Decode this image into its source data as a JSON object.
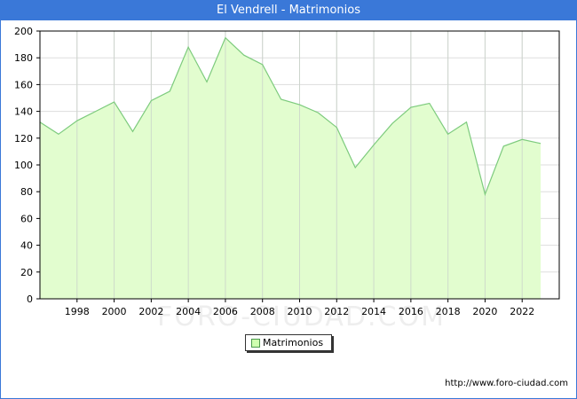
{
  "title": "El Vendrell - Matrimonios",
  "source_url": "http://www.foro-ciudad.com",
  "watermark": "FORO-CIUDAD.COM",
  "colors": {
    "title_bg": "#3a78d8",
    "fill": "#e2fdcf",
    "line": "#7dcb7d",
    "grid": "#dddddd",
    "swatch": "#cfffb0"
  },
  "chart_data": {
    "type": "area",
    "x": [
      1996,
      1997,
      1998,
      1999,
      2000,
      2001,
      2002,
      2003,
      2004,
      2005,
      2006,
      2007,
      2008,
      2009,
      2010,
      2011,
      2012,
      2013,
      2014,
      2015,
      2016,
      2017,
      2018,
      2019,
      2020,
      2021,
      2022,
      2023
    ],
    "series": [
      {
        "name": "Matrimonios",
        "values": [
          132,
          123,
          133,
          140,
          147,
          125,
          148,
          155,
          188,
          162,
          195,
          182,
          175,
          149,
          145,
          139,
          128,
          98,
          115,
          131,
          143,
          146,
          123,
          132,
          78,
          114,
          119,
          116
        ]
      }
    ],
    "xlim": [
      1996,
      2024
    ],
    "ylim": [
      0,
      200
    ],
    "xticks": [
      1998,
      2000,
      2002,
      2004,
      2006,
      2008,
      2010,
      2012,
      2014,
      2016,
      2018,
      2020,
      2022
    ],
    "yticks": [
      0,
      20,
      40,
      60,
      80,
      100,
      120,
      140,
      160,
      180,
      200
    ],
    "grid": true,
    "legend_position": "bottom-center"
  }
}
